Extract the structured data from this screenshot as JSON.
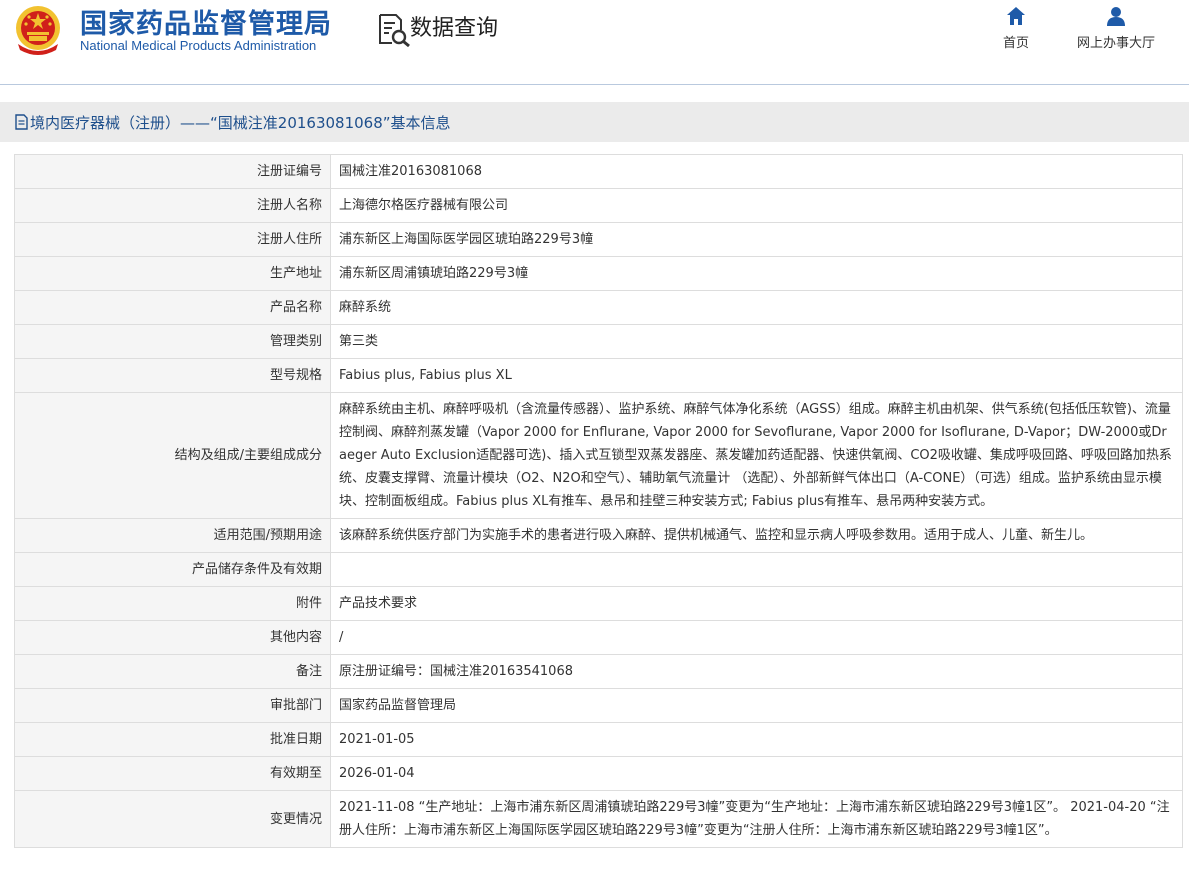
{
  "header": {
    "brand_cn": "国家药品监督管理局",
    "brand_en": "National Medical Products Administration",
    "query_title": "数据查询",
    "nav_home": "首页",
    "nav_hall": "网上办事大厅"
  },
  "title_bar": {
    "text": "境内医疗器械（注册）——“国械注准20163081068”基本信息"
  },
  "rows": [
    {
      "label": "注册证编号",
      "value": "国械注准20163081068"
    },
    {
      "label": "注册人名称",
      "value": "上海德尔格医疗器械有限公司"
    },
    {
      "label": "注册人住所",
      "value": "浦东新区上海国际医学园区琥珀路229号3幢"
    },
    {
      "label": "生产地址",
      "value": "浦东新区周浦镇琥珀路229号3幢"
    },
    {
      "label": "产品名称",
      "value": "麻醉系统"
    },
    {
      "label": "管理类别",
      "value": "第三类"
    },
    {
      "label": "型号规格",
      "value": "Fabius plus, Fabius plus XL"
    },
    {
      "label": "结构及组成/主要组成成分",
      "value": "麻醉系统由主机、麻醉呼吸机（含流量传感器）、监护系统、麻醉气体净化系统（AGSS）组成。麻醉主机由机架、供气系统(包括低压软管)、流量控制阀、麻醉剂蒸发罐（Vapor 2000 for Enflurane, Vapor 2000 for Sevoflurane, Vapor 2000 for Isoflurane, D-Vapor；DW-2000或Draeger Auto Exclusion适配器可选)、插入式互锁型双蒸发器座、蒸发罐加药适配器、快速供氧阀、CO2吸收罐、集成呼吸回路、呼吸回路加热系统、皮囊支撑臂、流量计模块（O2、N2O和空气）、辅助氧气流量计 （选配）、外部新鲜气体出口（A-CONE）（可选）组成。监护系统由显示模块、控制面板组成。Fabius plus XL有推车、悬吊和挂壁三种安装方式; Fabius plus有推车、悬吊两种安装方式。"
    },
    {
      "label": "适用范围/预期用途",
      "value": "该麻醉系统供医疗部门为实施手术的患者进行吸入麻醉、提供机械通气、监控和显示病人呼吸参数用。适用于成人、儿童、新生儿。"
    },
    {
      "label": "产品储存条件及有效期",
      "value": ""
    },
    {
      "label": "附件",
      "value": "产品技术要求"
    },
    {
      "label": "其他内容",
      "value": "/"
    },
    {
      "label": "备注",
      "value": "原注册证编号：国械注准20163541068"
    },
    {
      "label": "审批部门",
      "value": "国家药品监督管理局"
    },
    {
      "label": "批准日期",
      "value": "2021-01-05"
    },
    {
      "label": "有效期至",
      "value": "2026-01-04"
    },
    {
      "label": "变更情况",
      "value": "2021-11-08 “生产地址：上海市浦东新区周浦镇琥珀路229号3幢”变更为“生产地址：上海市浦东新区琥珀路229号3幢1区”。 2021-04-20 “注册人住所：上海市浦东新区上海国际医学园区琥珀路229号3幢”变更为“注册人住所：上海市浦东新区琥珀路229号3幢1区”。"
    }
  ],
  "colors": {
    "brand_blue": "#1e5aa8",
    "title_blue": "#1e4f8c",
    "emblem_red": "#d0201a",
    "emblem_gold": "#f2c230"
  },
  "icons": {
    "emblem": "national-emblem-icon",
    "query": "document-search-icon",
    "home": "home-icon",
    "hall": "user-icon",
    "title": "document-icon"
  }
}
